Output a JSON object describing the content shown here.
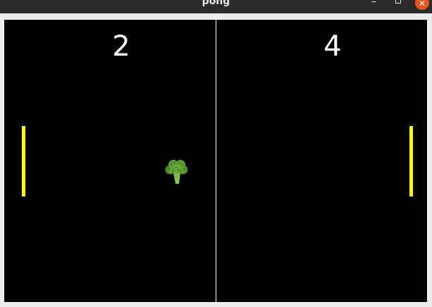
{
  "window": {
    "title": "pong",
    "minimize_icon": "minimize-icon",
    "maximize_icon": "maximize-icon",
    "close_icon": "close-icon",
    "close_glyph": "✕",
    "close_color": "#e95420"
  },
  "game": {
    "background_color": "#000000",
    "center_line_color": "#ffffff",
    "paddle_color": "#ffff00",
    "left_score": "2",
    "right_score": "4",
    "ball_icon": "broccoli-icon"
  }
}
